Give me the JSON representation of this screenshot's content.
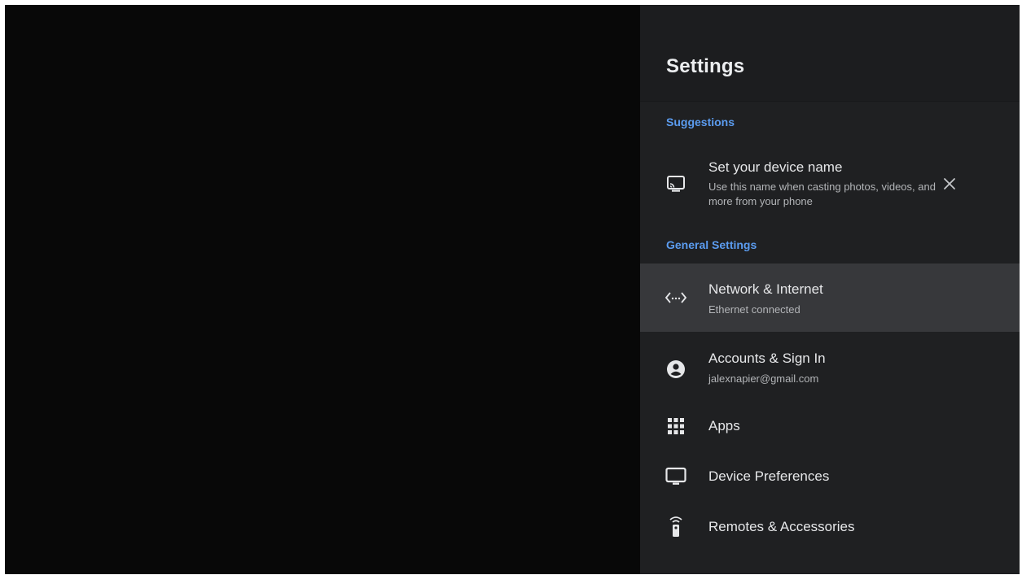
{
  "settings": {
    "title": "Settings",
    "suggestions_label": "Suggestions",
    "suggestion": {
      "title": "Set your device name",
      "subtitle": "Use this name when casting photos, videos, and more from your phone",
      "icon": "cast-icon",
      "dismiss_icon": "close-icon"
    },
    "general_label": "General Settings",
    "items": [
      {
        "label": "Network & Internet",
        "subtitle": "Ethernet connected",
        "icon": "network-icon",
        "focused": true
      },
      {
        "label": "Accounts & Sign In",
        "subtitle": "jalexnapier@gmail.com",
        "icon": "account-icon"
      },
      {
        "label": "Apps",
        "icon": "apps-grid-icon"
      },
      {
        "label": "Device Preferences",
        "icon": "tv-icon"
      },
      {
        "label": "Remotes & Accessories",
        "icon": "remote-icon"
      }
    ]
  },
  "colors": {
    "accent": "#5b9cf0",
    "panel_bg": "#1f2022",
    "focused_bg": "#37383b",
    "screen_bg": "#080808"
  }
}
